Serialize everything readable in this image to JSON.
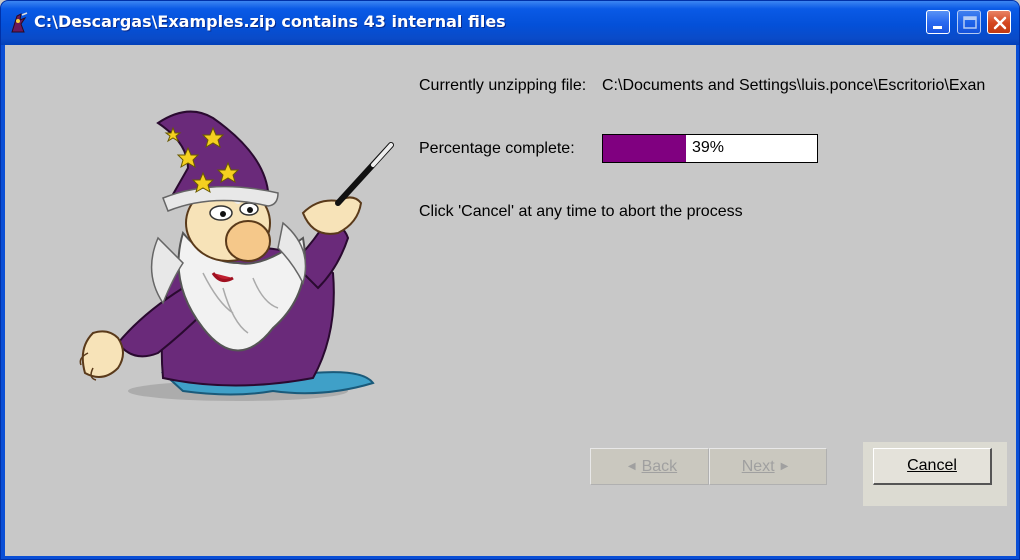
{
  "window": {
    "title": "C:\\Descargas\\Examples.zip contains 43 internal files"
  },
  "status": {
    "current_label": "Currently unzipping file:",
    "current_path": "C:\\Documents and Settings\\luis.ponce\\Escritorio\\Exan",
    "percent_label": "Percentage complete:",
    "percent_value": 39,
    "percent_text": "39%",
    "hint": "Click 'Cancel' at any time to abort the process"
  },
  "buttons": {
    "back_label": "Back",
    "next_label": "Next",
    "cancel_label": "Cancel"
  },
  "colors": {
    "progress_fill": "#800080",
    "titlebar": "#0a4fd6",
    "dialog_bg": "#c8c8c8"
  },
  "icons": {
    "app": "wizard-app-icon",
    "minimize": "minimize-icon",
    "maximize": "maximize-icon",
    "close": "close-icon",
    "back_arrow": "triangle-left-icon",
    "next_arrow": "triangle-right-icon",
    "illustration": "wizard-illustration"
  }
}
